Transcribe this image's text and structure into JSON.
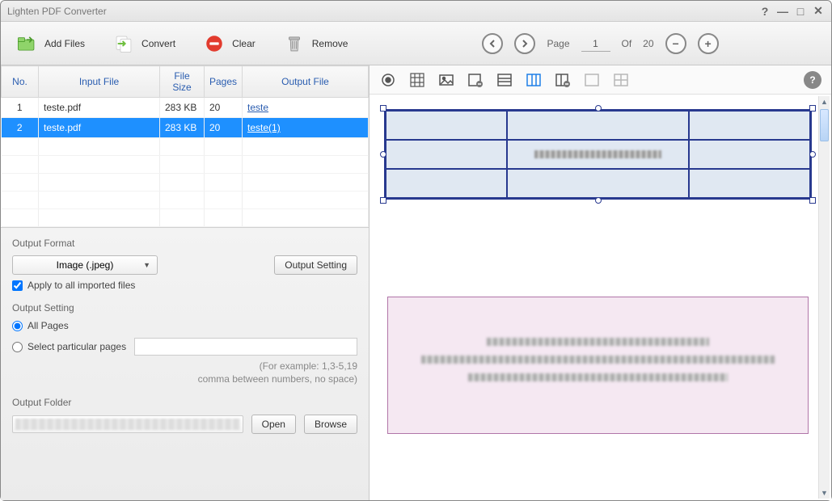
{
  "window": {
    "title": "Lighten PDF Converter"
  },
  "toolbar": {
    "addFiles": "Add Files",
    "convert": "Convert",
    "clear": "Clear",
    "remove": "Remove"
  },
  "paging": {
    "pageLabel": "Page",
    "current": "1",
    "ofLabel": "Of",
    "total": "20"
  },
  "table": {
    "headers": {
      "no": "No.",
      "inputFile": "Input File",
      "fileSize": "File Size",
      "pages": "Pages",
      "outputFile": "Output File"
    },
    "rows": [
      {
        "no": "1",
        "inputFile": "teste.pdf",
        "fileSize": "283 KB",
        "pages": "20",
        "outputFile": "teste",
        "selected": false
      },
      {
        "no": "2",
        "inputFile": "teste.pdf",
        "fileSize": "283 KB",
        "pages": "20",
        "outputFile": "teste(1)",
        "selected": true
      }
    ]
  },
  "outputFormat": {
    "title": "Output Format",
    "selected": "Image (.jpeg)",
    "applyAll": "Apply to all imported files",
    "outputSettingBtn": "Output Setting"
  },
  "outputSetting": {
    "title": "Output Setting",
    "allPages": "All Pages",
    "selectParticular": "Select particular pages",
    "hintLine1": "(For example: 1,3-5,19",
    "hintLine2": "comma between numbers, no space)"
  },
  "outputFolder": {
    "title": "Output Folder",
    "open": "Open",
    "browse": "Browse"
  }
}
